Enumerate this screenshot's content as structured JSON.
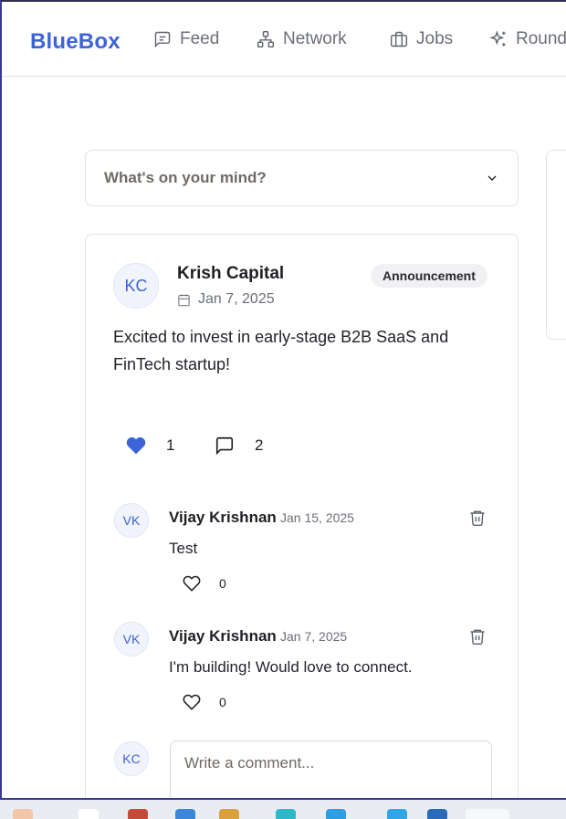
{
  "nav": {
    "brand": "BlueBox",
    "items": [
      {
        "label": "Feed",
        "icon": "message-square-icon"
      },
      {
        "label": "Network",
        "icon": "network-icon"
      },
      {
        "label": "Jobs",
        "icon": "briefcase-icon"
      },
      {
        "label": "Round",
        "icon": "sparkles-icon"
      }
    ]
  },
  "composer": {
    "placeholder": "What's on your mind?"
  },
  "post": {
    "initials": "KC",
    "author": "Krish Capital",
    "date": "Jan 7, 2025",
    "badge": "Announcement",
    "text": "Excited to invest in early-stage B2B SaaS and FinTech startup!",
    "likes": "1",
    "comments": "2"
  },
  "comments": [
    {
      "initials": "VK",
      "author": "Vijay Krishnan",
      "date": "Jan 15, 2025",
      "text": "Test",
      "likes": "0"
    },
    {
      "initials": "VK",
      "author": "Vijay Krishnan",
      "date": "Jan 7, 2025",
      "text": "I'm building! Would love to connect.",
      "likes": "0"
    }
  ],
  "new_comment": {
    "initials": "KC",
    "placeholder": "Write a comment..."
  },
  "colors": {
    "brand": "#3d63d8",
    "heart": "#3d63d8"
  }
}
